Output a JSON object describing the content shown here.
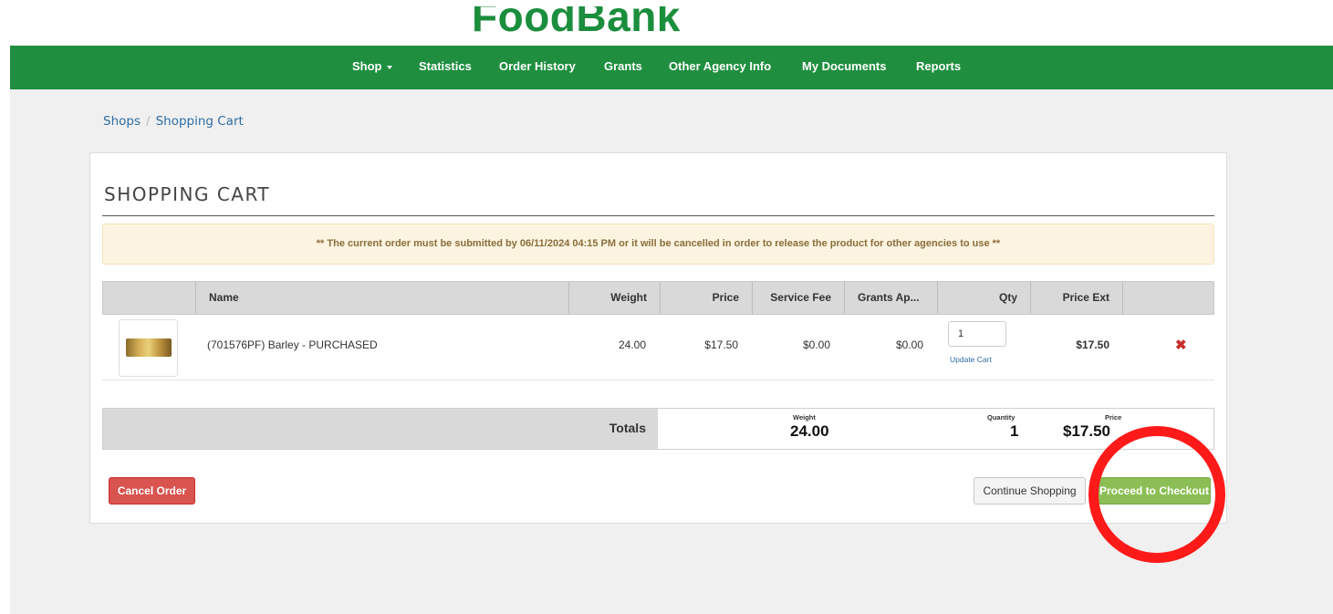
{
  "brand": {
    "logo_text": "FoodBank",
    "logo_color": "#1b8e3d"
  },
  "nav": {
    "bg_color": "#1f8f3f",
    "items": [
      {
        "label": "Shop"
      },
      {
        "label": "Statistics"
      },
      {
        "label": "Order History"
      },
      {
        "label": "Grants"
      },
      {
        "label": "Other Agency Info"
      },
      {
        "label": "My Documents"
      },
      {
        "label": "Reports"
      }
    ]
  },
  "breadcrumb": {
    "items": [
      "Shops",
      "Shopping Cart"
    ],
    "separator": "/"
  },
  "cart": {
    "title": "SHOPPING CART",
    "notice": "** The current order must be submitted by 06/11/2024 04:15 PM or it will be cancelled in order to release the product for other agencies to use **",
    "columns": {
      "name": "Name",
      "weight": "Weight",
      "price": "Price",
      "service_fee": "Service Fee",
      "grants": "Grants Ap...",
      "qty": "Qty",
      "price_ext": "Price Ext"
    },
    "items": [
      {
        "name": "(701576PF) Barley - PURCHASED",
        "weight": "24.00",
        "price": "$17.50",
        "service_fee": "$0.00",
        "grants": "$0.00",
        "qty": "1",
        "update_label": "Update Cart",
        "price_ext": "$17.50",
        "remove_icon": "remove-x-icon"
      }
    ],
    "totals": {
      "label": "Totals",
      "weight_label": "Weight",
      "weight": "24.00",
      "quantity_label": "Quantity",
      "quantity": "1",
      "price_label": "Price",
      "price": "$17.50"
    }
  },
  "actions": {
    "cancel": "Cancel Order",
    "continue": "Continue Shopping",
    "checkout": "Proceed to Checkout"
  },
  "colors": {
    "cancel": "#d9534f",
    "checkout": "#8bbf55",
    "highlight_ring": "#ff1a1a"
  }
}
